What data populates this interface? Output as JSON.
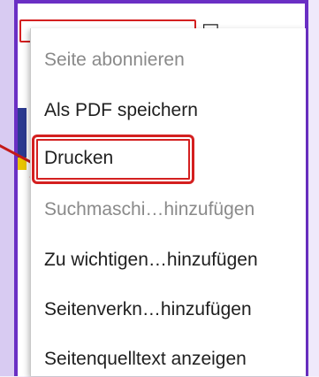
{
  "menu": {
    "items": [
      {
        "label": "Seite abonnieren",
        "enabled": false
      },
      {
        "label": "Als PDF speichern",
        "enabled": true
      },
      {
        "label": "Drucken",
        "enabled": true,
        "highlighted": true
      },
      {
        "label": "Suchmaschi…hinzufügen",
        "enabled": false
      },
      {
        "label": "Zu wichtigen…hinzufügen",
        "enabled": true
      },
      {
        "label": "Seitenverkn…hinzufügen",
        "enabled": true
      },
      {
        "label": "Seitenquelltext anzeigen",
        "enabled": true
      }
    ]
  },
  "colors": {
    "frame": "#6a2fc4",
    "annotation": "#d42020",
    "menu_text": "#1f1f1f",
    "menu_text_disabled": "#8a8a8a"
  }
}
